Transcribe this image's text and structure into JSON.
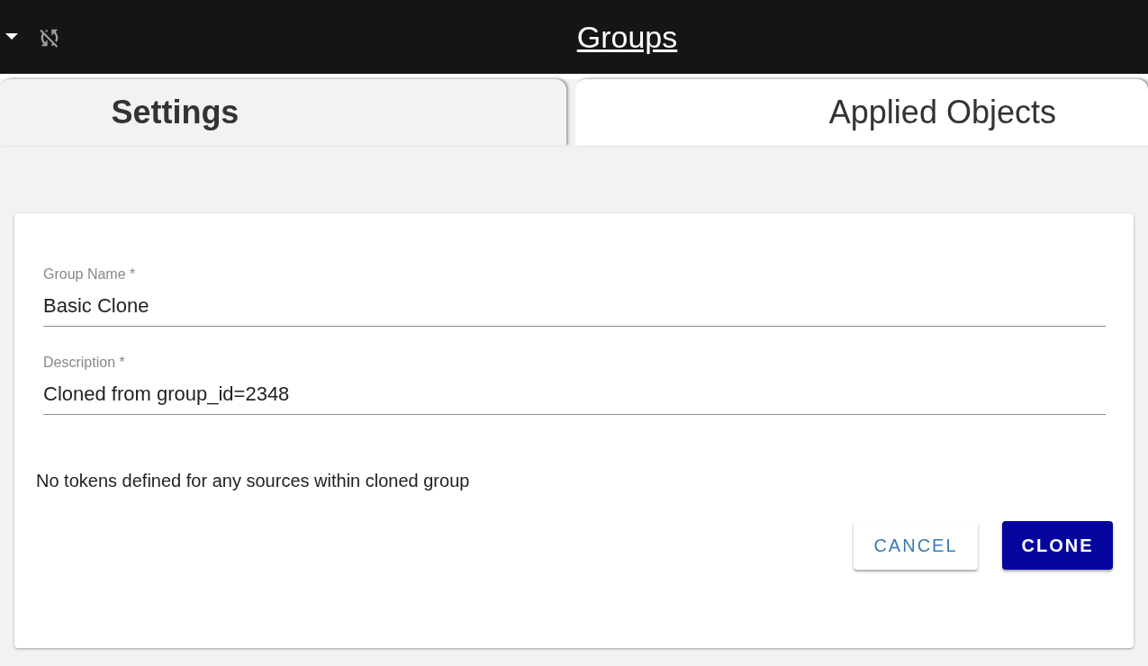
{
  "header": {
    "title": "Groups"
  },
  "tabs": [
    {
      "label": "Settings",
      "selected": true
    },
    {
      "label": "Applied Objects",
      "selected": false
    }
  ],
  "form": {
    "fields": [
      {
        "label": "Group Name *",
        "value": "Basic Clone"
      },
      {
        "label": "Description *",
        "value": "Cloned from group_id=2348"
      }
    ],
    "message": "No tokens defined for any sources within cloned group",
    "buttons": [
      {
        "label": "CANCEL",
        "kind": "secondary"
      },
      {
        "label": "CLONE",
        "kind": "primary"
      }
    ]
  }
}
